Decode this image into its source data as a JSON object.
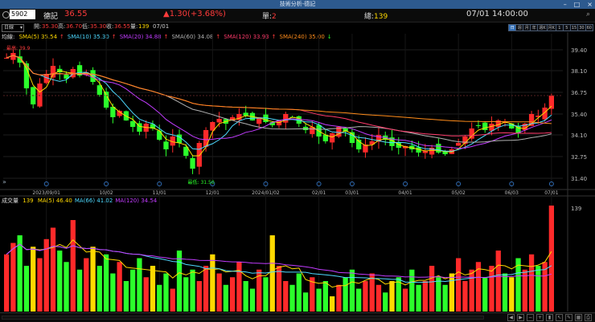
{
  "window": {
    "title": "技術分析-德記"
  },
  "quote": {
    "code": "5902",
    "name": "德記",
    "price": "36.55",
    "change": "▲1.30(+3.68%)",
    "single_label": "單:",
    "single_value": "2",
    "total_label": "總:",
    "total_value": "139",
    "datetime": "07/01 14:00:00"
  },
  "ohlc": {
    "open_label": "開:",
    "open": "35.30",
    "high_label": "高:",
    "high": "36.70",
    "low_label": "低:",
    "low": "35.30",
    "close_label": "收:",
    "close": "36.55",
    "volume_label": "量:",
    "volume": "139",
    "date": "07/01"
  },
  "toolbar": {
    "period_select": "日線",
    "period_buttons": [
      "日",
      "週",
      "月",
      "年",
      "週K",
      "月K",
      "1",
      "5",
      "15",
      "30",
      "60"
    ],
    "active_index": 0
  },
  "ma_legend": {
    "label": "均線:",
    "items": [
      {
        "text": "SMA(5) 35.54",
        "arrow": "↑",
        "color": "#ffd900"
      },
      {
        "text": "SMA(10) 35.30",
        "arrow": "↑",
        "color": "#4dd9ff"
      },
      {
        "text": "SMA(20) 34.88",
        "arrow": "↑",
        "color": "#c23cff"
      },
      {
        "text": "SMA(60) 34.08",
        "arrow": "↑",
        "color": "#b0b0b0"
      },
      {
        "text": "SMA(120) 33.93",
        "arrow": "↑",
        "color": "#ff3b6b"
      },
      {
        "text": "SMA(240) 35.00",
        "arrow": "↓",
        "color": "#ff8c1a"
      }
    ]
  },
  "chart_annotations": {
    "high_label": "最高: 39.9",
    "low_label": "最低: 31.50"
  },
  "vol_legend": {
    "label": "成交量",
    "value": "139",
    "items": [
      {
        "text": "MA(5) 46.40",
        "color": "#ffd900"
      },
      {
        "text": "MA(66) 41.02",
        "color": "#4dd9ff"
      },
      {
        "text": "MA(120) 34.54",
        "color": "#c23cff"
      }
    ],
    "axis_max": "139"
  },
  "colors": {
    "up": "#ff2a2a",
    "down": "#2bff2b",
    "background": "#000000",
    "grid": "#1e1e1e"
  },
  "chart_data": [
    {
      "type": "candlestick",
      "title": "",
      "y_ticks": [
        "39.40",
        "38.10",
        "36.75",
        "35.40",
        "34.10",
        "32.75",
        "31.40"
      ],
      "x_ticks": [
        "2023/09/01",
        "10/02",
        "11/01",
        "12/01",
        "2024/01/02",
        "02/01",
        "03/01",
        "04/01",
        "05/02",
        "06/03",
        "07/01"
      ],
      "ylim": [
        31.0,
        40.0
      ],
      "trend": [
        38.9,
        39.2,
        38.6,
        37.0,
        36.0,
        37.3,
        37.9,
        38.4,
        38.0,
        37.6,
        38.2,
        37.8,
        38.0,
        37.4,
        36.6,
        35.8,
        35.2,
        35.6,
        35.0,
        34.6,
        34.3,
        34.8,
        34.5,
        33.8,
        33.2,
        34.0,
        33.6,
        32.8,
        32.0,
        33.6,
        34.4,
        34.9,
        35.1,
        34.8,
        35.2,
        35.4,
        35.3,
        35.0,
        35.2,
        34.9,
        34.7,
        35.0,
        35.4,
        35.2,
        34.8,
        34.4,
        34.6,
        34.0,
        33.7,
        34.2,
        34.6,
        34.3,
        33.6,
        33.2,
        33.5,
        33.7,
        34.1,
        33.8,
        33.4,
        33.3,
        33.4,
        33.2,
        33.0,
        33.1,
        33.3,
        33.0,
        32.9,
        33.2,
        33.6,
        34.0,
        34.5,
        34.7,
        34.4,
        34.8,
        35.0,
        34.9,
        34.5,
        34.2,
        34.8,
        35.4,
        35.3,
        35.8,
        36.55
      ],
      "current_price": 36.55
    },
    {
      "type": "bar",
      "title": "",
      "ylim": [
        0,
        139
      ],
      "values": [
        75,
        90,
        100,
        60,
        85,
        70,
        95,
        110,
        80,
        65,
        120,
        55,
        70,
        85,
        60,
        75,
        50,
        65,
        40,
        55,
        70,
        45,
        60,
        35,
        50,
        30,
        80,
        45,
        55,
        40,
        60,
        75,
        50,
        35,
        45,
        65,
        40,
        30,
        55,
        45,
        100,
        60,
        40,
        35,
        50,
        25,
        45,
        30,
        40,
        20,
        35,
        45,
        55,
        30,
        40,
        50,
        35,
        25,
        40,
        45,
        30,
        55,
        35,
        40,
        60,
        45,
        35,
        50,
        70,
        40,
        55,
        65,
        45,
        60,
        80,
        50,
        45,
        70,
        55,
        75,
        60,
        65,
        139
      ]
    }
  ]
}
